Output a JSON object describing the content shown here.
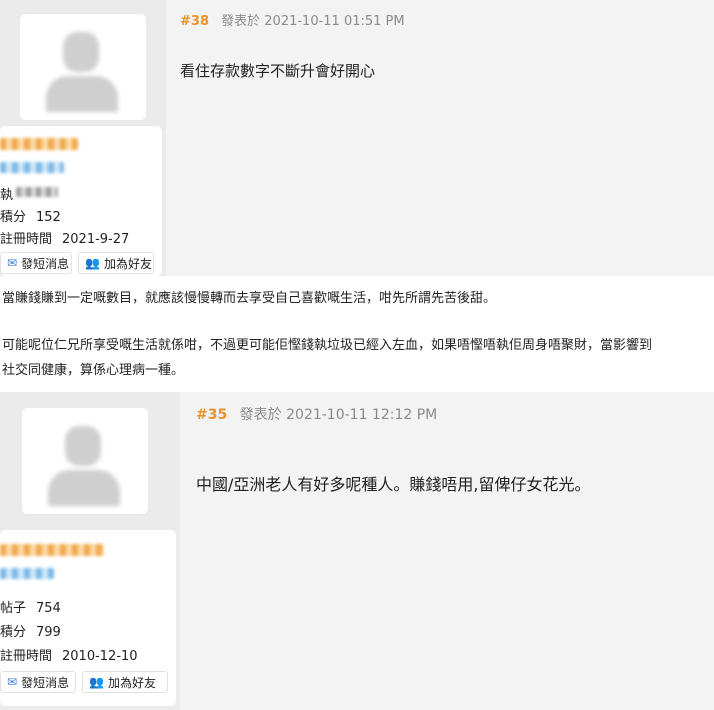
{
  "posts": [
    {
      "number": "#38",
      "posted_label": "發表於",
      "timestamp": "2021-10-11 01:51 PM",
      "content": "看住存款數字不斷升會好開心",
      "user": {
        "stats": [
          {
            "label": "積分",
            "value": "152"
          },
          {
            "label": "註冊時間",
            "value": "2021-9-27"
          }
        ],
        "partial_label": "執"
      }
    },
    {
      "number": "#35",
      "posted_label": "發表於",
      "timestamp": "2021-10-11 12:12 PM",
      "content": "中國/亞洲老人有好多呢種人。賺錢唔用,留俾仔女花光。",
      "user": {
        "stats": [
          {
            "label": "帖子",
            "value": "754"
          },
          {
            "label": "積分",
            "value": "799"
          },
          {
            "label": "註冊時間",
            "value": "2010-12-10"
          }
        ]
      }
    }
  ],
  "buttons": {
    "send_message": "發短消息",
    "add_friend": "加為好友"
  },
  "body_text": {
    "line1": "當賺錢賺到一定嘅數目，就應該慢慢轉而去享受自己喜歡嘅生活，咁先所謂先苦後甜。",
    "line2": "可能呢位仁兄所享受嘅生活就係咁，不過更可能佢慳錢執垃圾已經入左血，如果唔慳唔執佢周身唔聚財，當影響到",
    "line3": "社交同健康，算係心理病一種。"
  },
  "icons": {
    "mail": "mail-icon",
    "friend": "add-friend-icon"
  },
  "colors": {
    "accent": "#e8932c",
    "panel": "#f3f3f3",
    "link_blue": "#3a7bd5"
  }
}
